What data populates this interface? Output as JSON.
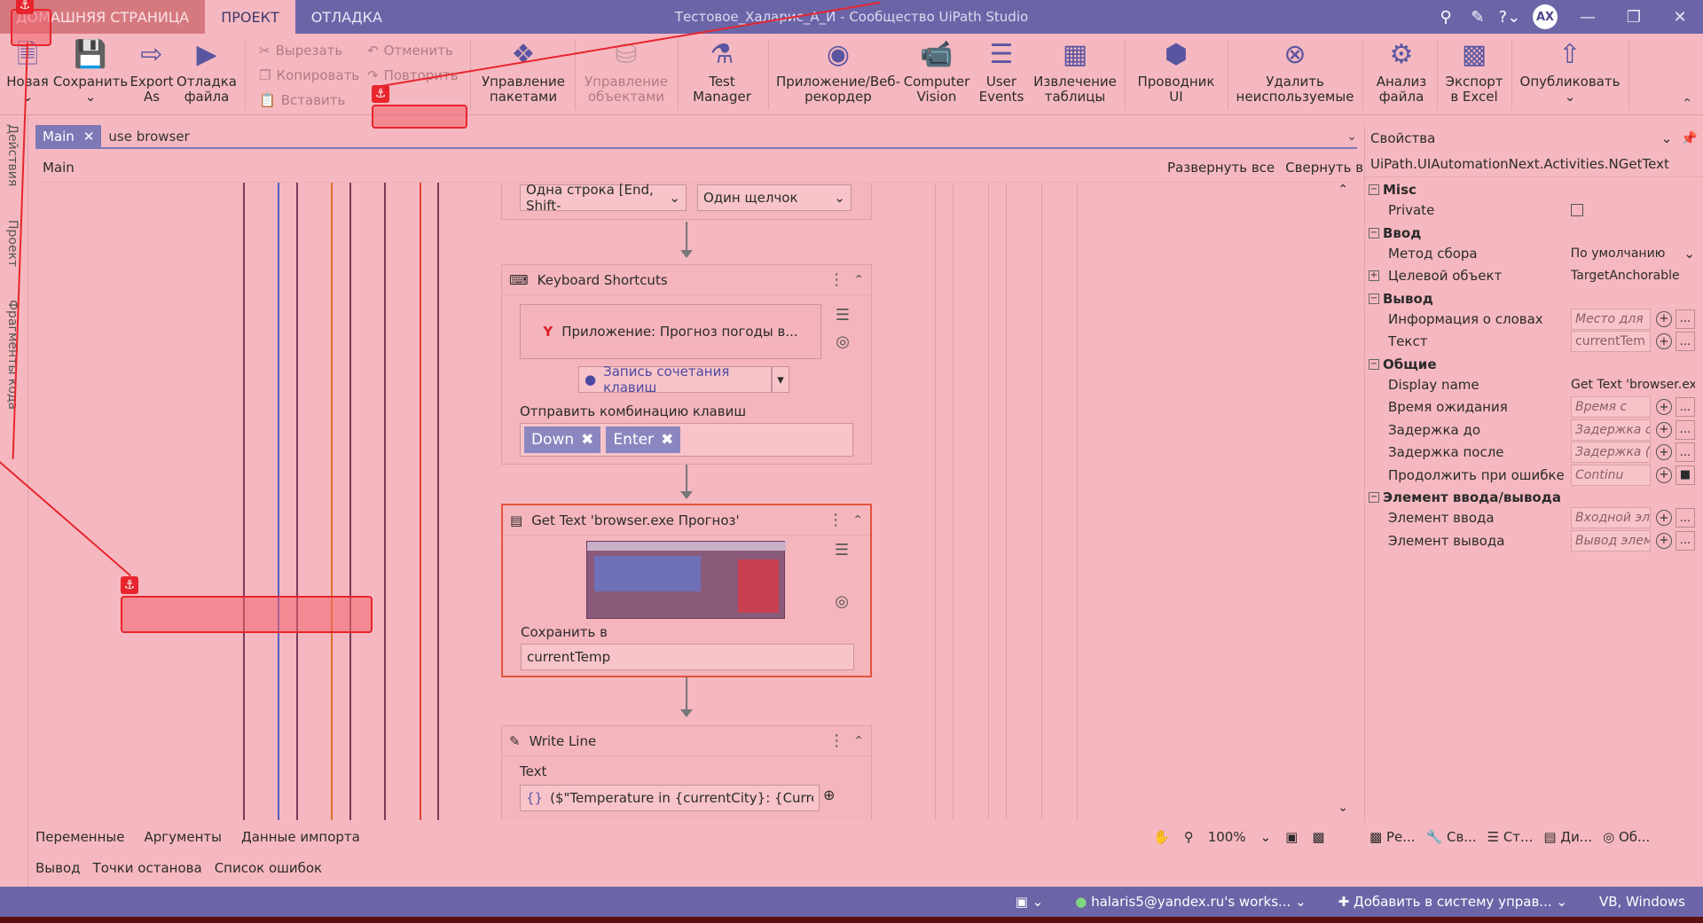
{
  "menu": {
    "tabs": [
      "ДОМАШНЯЯ СТРАНИЦА",
      "ПРОЕКТ",
      "ОТЛАДКА"
    ],
    "window_title": "Тестовое_Халарис_А_И - Сообщество UiPath Studio",
    "avatar": "AX"
  },
  "ribbon": {
    "new": "Новая",
    "save": "Сохранить",
    "export_as": "Export As",
    "debug_file": "Отладка файла",
    "cut": "Вырезать",
    "copy": "Копировать",
    "paste": "Вставить",
    "undo": "Отменить",
    "redo": "Повторить",
    "manage_packages": "Управление пакетами",
    "manage_objects": "Управление объектами",
    "test_manager": "Test Manager",
    "app_recorder": "Приложение/Веб-рекордер",
    "computer_vision": "Computer Vision",
    "user_events": "User Events",
    "table_extraction": "Извлечение таблицы",
    "ui_explorer": "Проводник UI",
    "remove_unused": "Удалить неиспользуемые",
    "file_analysis": "Анализ файла",
    "export_excel": "Экспорт в Excel",
    "publish": "Опубликовать"
  },
  "left_rail": [
    "Действия",
    "Проект",
    "Фрагменты кода"
  ],
  "doc_tabs": {
    "main_tab": "Main",
    "search": "use browser"
  },
  "breadcrumb": "Main",
  "expand_all": "Развернуть все",
  "collapse_all": "Свернуть все",
  "workflow": {
    "top_dropdowns": [
      "Одна строка [End, Shift-",
      "Один щелчок"
    ],
    "keyboard": {
      "title": "Keyboard Shortcuts",
      "target": "Приложение: Прогноз погоды в...",
      "record_label": "Запись сочетания клавиш",
      "send_label": "Отправить комбинацию клавиш",
      "keys": [
        "Down",
        "Enter"
      ]
    },
    "get_text": {
      "title": "Get Text 'browser.exe Прогноз'",
      "save_label": "Сохранить в",
      "save_value": "currentTemp"
    },
    "write_line": {
      "title": "Write Line",
      "text_label": "Text",
      "text_value": "($\"Temperature in {currentCity}: {CurrentTe"
    }
  },
  "bottom_tabs": [
    "Переменные",
    "Аргументы",
    "Данные импорта"
  ],
  "zoom": "100%",
  "output_tabs": [
    "Вывод",
    "Точки останова",
    "Список ошибок"
  ],
  "properties": {
    "header": "Свойства",
    "type": "UiPath.UIAutomationNext.Activities.NGetText",
    "rows": [
      {
        "kind": "cat",
        "label": "Misc"
      },
      {
        "kind": "row",
        "label": "Private",
        "value": ""
      },
      {
        "kind": "cat",
        "label": "Ввод"
      },
      {
        "kind": "row",
        "label": "Метод сбора",
        "value": "По умолчанию"
      },
      {
        "kind": "row",
        "label": "Целевой объект",
        "value": "TargetAnchorable"
      },
      {
        "kind": "cat",
        "label": "Вывод"
      },
      {
        "kind": "row",
        "label": "Информация о словах",
        "value": "Место для"
      },
      {
        "kind": "row",
        "label": "Текст",
        "value": "currentTem"
      },
      {
        "kind": "cat",
        "label": "Общие"
      },
      {
        "kind": "row",
        "label": "Display name",
        "value": "Get Text 'browser.exe"
      },
      {
        "kind": "row",
        "label": "Время ожидания",
        "value": "Время с"
      },
      {
        "kind": "row",
        "label": "Задержка до",
        "value": "Задержка с"
      },
      {
        "kind": "row",
        "label": "Задержка после",
        "value": "Задержка ("
      },
      {
        "kind": "row",
        "label": "Продолжить при ошибке",
        "value": "Continu"
      },
      {
        "kind": "cat",
        "label": "Элемент ввода/вывода"
      },
      {
        "kind": "row",
        "label": "Элемент ввода",
        "value": "Входной эл"
      },
      {
        "kind": "row",
        "label": "Элемент вывода",
        "value": "Вывод элем"
      }
    ],
    "footer_tabs": [
      "Ре...",
      "Св...",
      "Ст...",
      "Ди...",
      "Об..."
    ]
  },
  "status": {
    "account": "halaris5@yandex.ru's works...",
    "add_to_source": "Добавить в систему управ...",
    "platform": "VB, Windows"
  },
  "colors": {
    "accent": "#6b65a8",
    "annotation": "#e8252c",
    "selected_border": "#e2543e"
  }
}
